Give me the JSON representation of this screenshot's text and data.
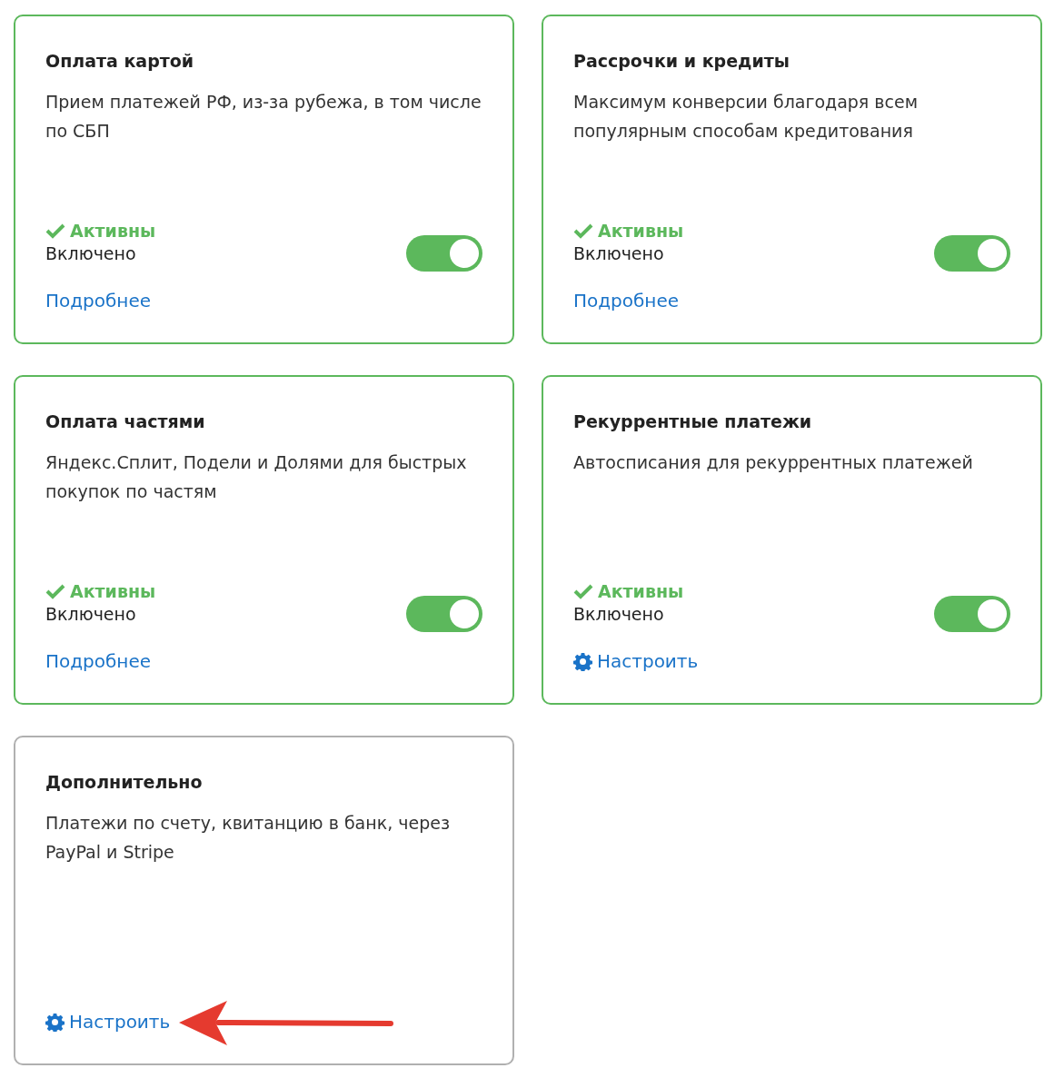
{
  "cards": [
    {
      "title": "Оплата картой",
      "description": "Прием платежей РФ, из-за рубежа, в том числе по СБП",
      "active": true,
      "status": "Активны",
      "toggle": {
        "label": "Включено",
        "on": true
      },
      "link": {
        "kind": "details",
        "text": "Подробнее"
      }
    },
    {
      "title": "Рассрочки и кредиты",
      "description": "Максимум конверсии благодаря всем популярным способам кредитования",
      "active": true,
      "status": "Активны",
      "toggle": {
        "label": "Включено",
        "on": true
      },
      "link": {
        "kind": "details",
        "text": "Подробнее"
      }
    },
    {
      "title": "Оплата частями",
      "description": "Яндекс.Сплит, Подели и Долями для быстрых покупок по частям",
      "active": true,
      "status": "Активны",
      "toggle": {
        "label": "Включено",
        "on": true
      },
      "link": {
        "kind": "details",
        "text": "Подробнее"
      }
    },
    {
      "title": "Рекуррентные платежи",
      "description": "Автосписания для рекуррентных платежей",
      "active": true,
      "status": "Активны",
      "toggle": {
        "label": "Включено",
        "on": true
      },
      "link": {
        "kind": "settings",
        "text": "Настроить"
      }
    },
    {
      "title": "Дополнительно",
      "description": "Платежи по счету, квитанцию в банк, через PayPal и Stripe",
      "active": false,
      "link": {
        "kind": "settings",
        "text": "Настроить"
      },
      "annotation": {
        "kind": "arrow"
      }
    }
  ]
}
